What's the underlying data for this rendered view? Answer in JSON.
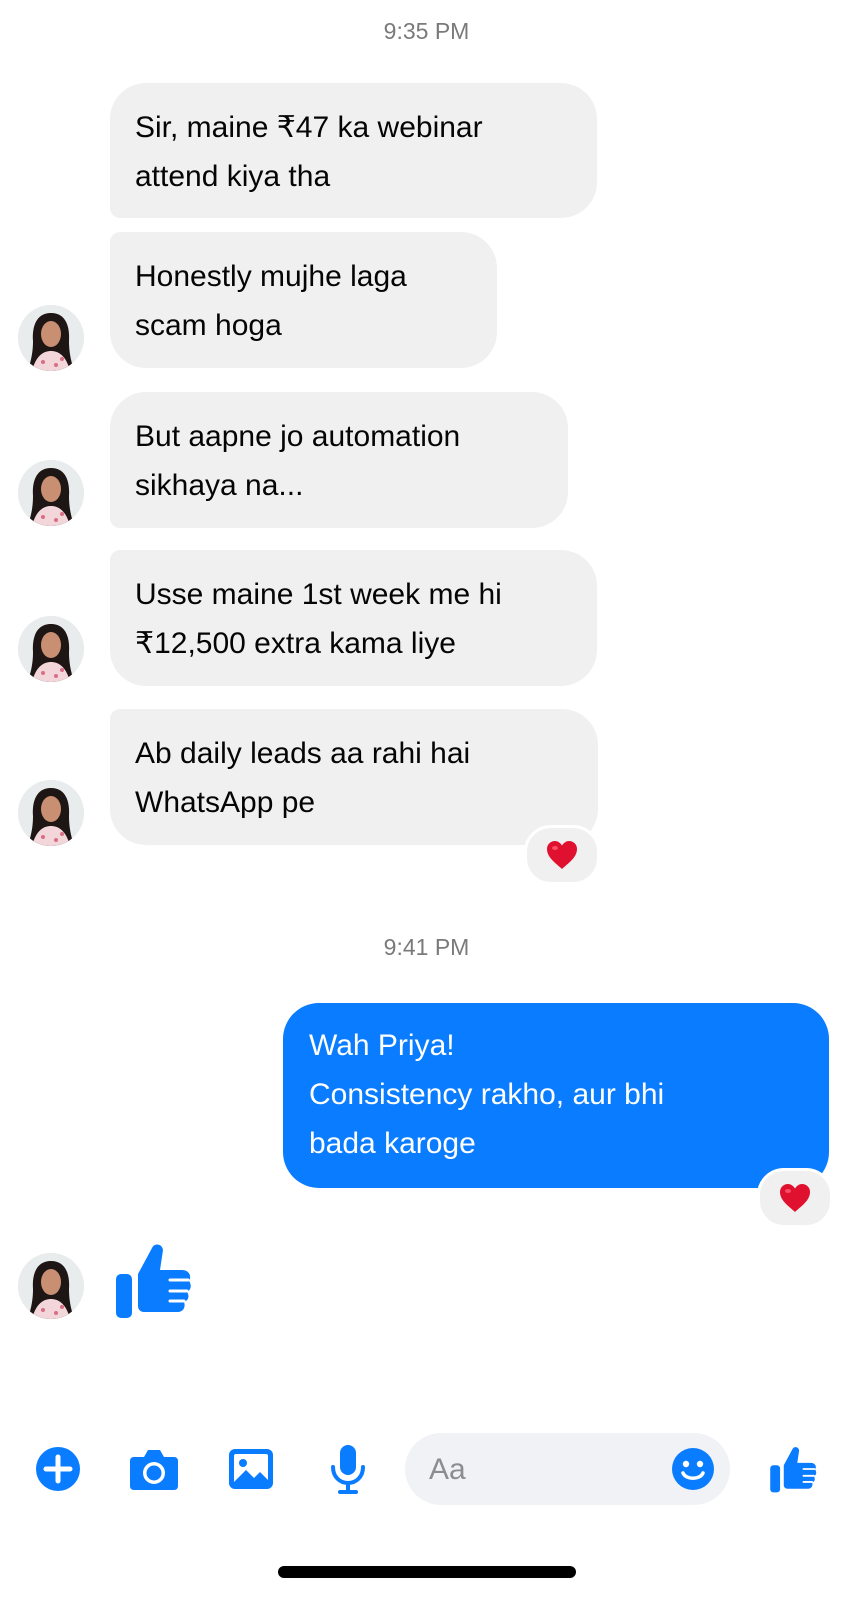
{
  "theme": {
    "accent": "#0a7cff",
    "incoming_bubble": "#f0f0f0",
    "heart": "#e0102f"
  },
  "timestamps": [
    "9:35 PM",
    "9:41 PM"
  ],
  "messages": [
    {
      "direction": "incoming",
      "text": "Sir, maine ₹47 ka webinar\nattend kiya tha",
      "avatar": false
    },
    {
      "direction": "incoming",
      "text": "Honestly mujhe laga\nscam hoga",
      "avatar": true
    },
    {
      "direction": "incoming",
      "text": "But aapne jo automation\nsikhaya na...",
      "avatar": true
    },
    {
      "direction": "incoming",
      "text": "Usse maine 1st week me hi\n₹12,500 extra kama liye",
      "avatar": true
    },
    {
      "direction": "incoming",
      "text": "Ab daily leads aa rahi hai\nWhatsApp pe",
      "avatar": true,
      "reaction": "heart-icon"
    },
    {
      "direction": "outgoing",
      "text": "Wah Priya!\nConsistency rakho, aur bhi\nbada karoge",
      "reaction": "heart-icon"
    },
    {
      "direction": "incoming",
      "type": "like-sticker",
      "icon": "thumbs-up-icon",
      "avatar": true
    }
  ],
  "composer": {
    "placeholder": "Aa",
    "icons": [
      "plus-circle-icon",
      "camera-icon",
      "image-icon",
      "microphone-icon",
      "emoji-icon",
      "thumbs-up-icon"
    ]
  }
}
